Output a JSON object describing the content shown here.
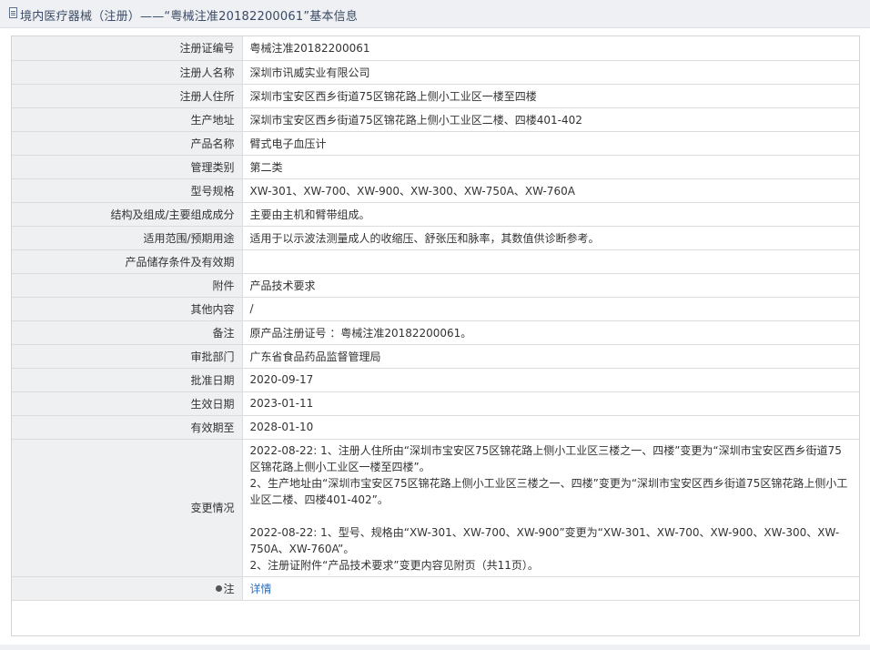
{
  "header": {
    "title": "境内医疗器械（注册）——“粤械注准20182200061”基本信息"
  },
  "fields": [
    {
      "label": "注册证编号",
      "value": "粤械注准20182200061"
    },
    {
      "label": "注册人名称",
      "value": "深圳市讯威实业有限公司"
    },
    {
      "label": "注册人住所",
      "value": "深圳市宝安区西乡街道75区锦花路上侧小工业区一楼至四楼"
    },
    {
      "label": "生产地址",
      "value": "深圳市宝安区西乡街道75区锦花路上侧小工业区二楼、四楼401-402"
    },
    {
      "label": "产品名称",
      "value": "臂式电子血压计"
    },
    {
      "label": "管理类别",
      "value": "第二类"
    },
    {
      "label": "型号规格",
      "value": "XW-301、XW-700、XW-900、XW-300、XW-750A、XW-760A"
    },
    {
      "label": "结构及组成/主要组成成分",
      "value": "主要由主机和臂带组成。"
    },
    {
      "label": "适用范围/预期用途",
      "value": "适用于以示波法测量成人的收缩压、舒张压和脉率，其数值供诊断参考。"
    },
    {
      "label": "产品储存条件及有效期",
      "value": ""
    },
    {
      "label": "附件",
      "value": "产品技术要求"
    },
    {
      "label": "其他内容",
      "value": "/"
    },
    {
      "label": "备注",
      "value": "原产品注册证号 ：粤械注准20182200061。"
    },
    {
      "label": "审批部门",
      "value": "广东省食品药品监督管理局"
    },
    {
      "label": "批准日期",
      "value": "2020-09-17"
    },
    {
      "label": "生效日期",
      "value": "2023-01-11"
    },
    {
      "label": "有效期至",
      "value": "2028-01-10"
    }
  ],
  "changes": {
    "label": "变更情况",
    "entries": [
      [
        "2022-08-22: 1、注册人住所由“深圳市宝安区75区锦花路上侧小工业区三楼之一、四楼”变更为“深圳市宝安区西乡街道75区锦花路上侧小工业区一楼至四楼”。",
        "2、生产地址由“深圳市宝安区75区锦花路上侧小工业区三楼之一、四楼”变更为“深圳市宝安区西乡街道75区锦花路上侧小工业区二楼、四楼401-402”。"
      ],
      [
        "2022-08-22: 1、型号、规格由“XW-301、XW-700、XW-900”变更为“XW-301、XW-700、XW-900、XW-300、XW-750A、XW-760A”。",
        "2、注册证附件“产品技术要求”变更内容见附页（共11页）。"
      ]
    ]
  },
  "note": {
    "label": "注",
    "link_text": "详情"
  },
  "colors": {
    "label_bg": "#eef0f2",
    "border": "#dcdcdc",
    "link": "#2f6fbf",
    "header_bg": "#eef0f3"
  }
}
